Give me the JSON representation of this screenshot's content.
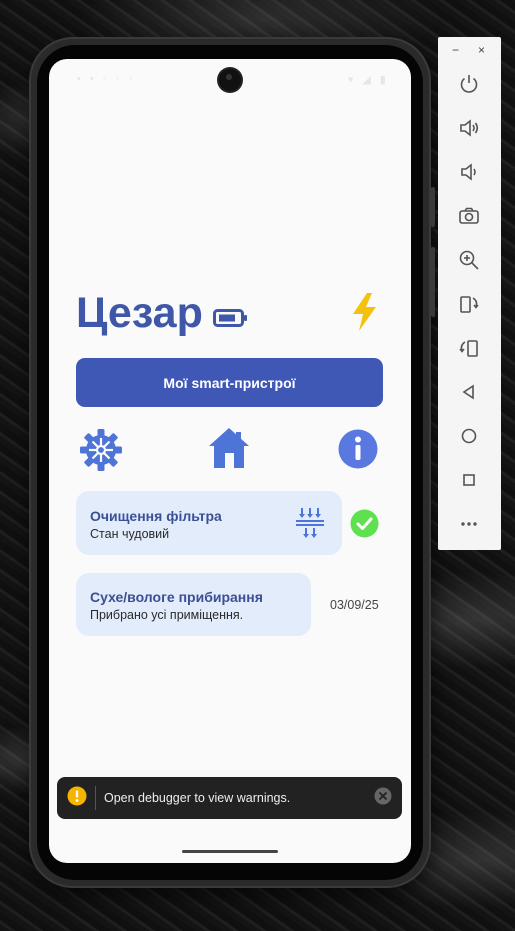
{
  "status_bar": {
    "left": "• • ◦ ◦ ◦",
    "right": "▾ ◢ ▮"
  },
  "app": {
    "title": "Цезар",
    "primary_button": "Мої smart-пристрої",
    "accent": "#3f57a8",
    "button_color": "#3f57b5",
    "card_bg": "#e3ecfb"
  },
  "icons": {
    "battery": "battery-icon",
    "bolt": "bolt-icon",
    "gear": "gear-icon",
    "home": "home-icon",
    "info": "info-icon",
    "filter": "filter-icon",
    "check": "check-icon"
  },
  "cards": [
    {
      "title": "Очищення фільтра",
      "subtitle": "Стан чудовий"
    },
    {
      "title": "Сухе/вологе прибирання",
      "subtitle": "Прибрано усі приміщення.",
      "date": "03/09/25"
    }
  ],
  "toast": {
    "text": "Open debugger to view warnings."
  },
  "emulator": {
    "minimize": "−",
    "close": "×",
    "controls": [
      "power",
      "volume-up",
      "volume-down",
      "screenshot",
      "zoom",
      "rotate-left",
      "rotate-right",
      "back",
      "home",
      "overview",
      "more"
    ]
  }
}
